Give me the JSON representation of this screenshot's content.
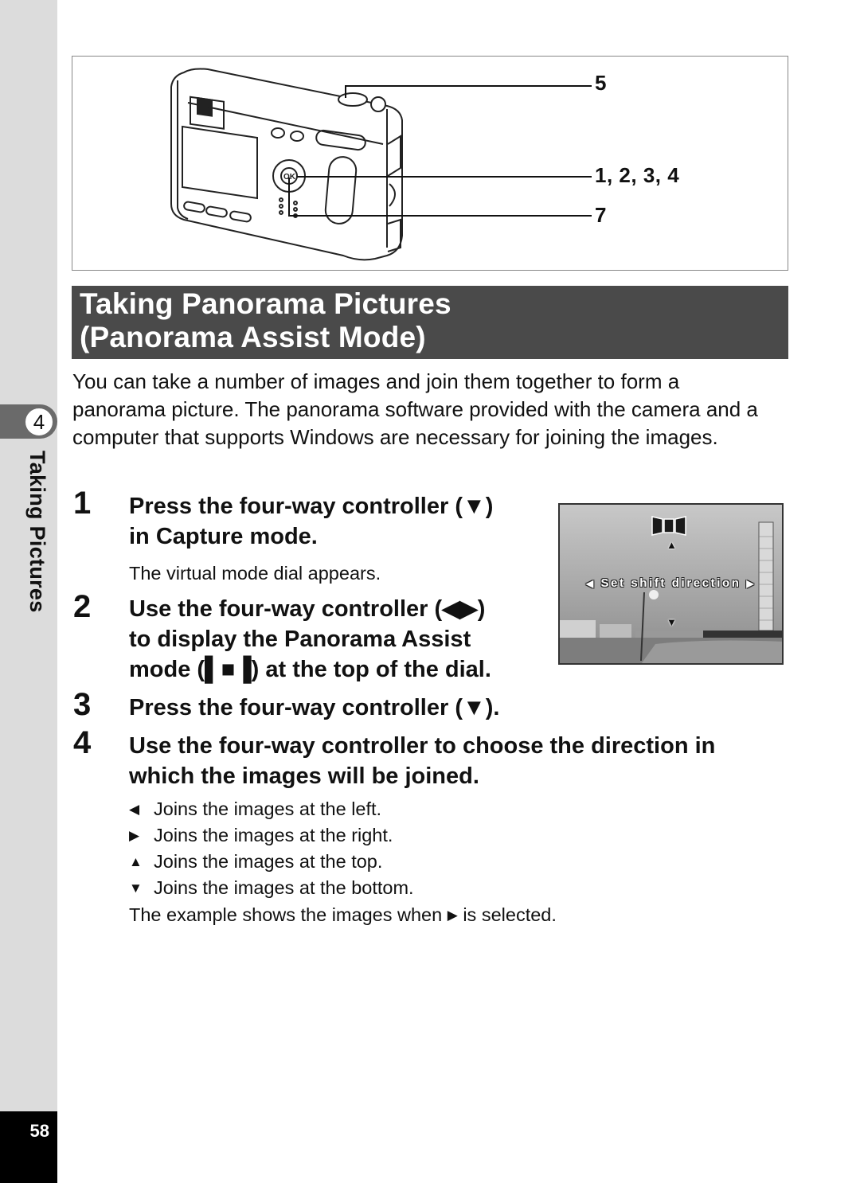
{
  "sidebar": {
    "chapter_number": "4",
    "chapter_label": "Taking Pictures",
    "page_number": "58"
  },
  "illustration": {
    "icon": "camera-back-view-icon",
    "callouts": {
      "shutter": "5",
      "controller": "1, 2, 3, 4",
      "ok_button": "7"
    }
  },
  "section": {
    "title_line1": "Taking Panorama Pictures",
    "title_line2": "(Panorama Assist Mode)"
  },
  "intro": "You can take a number of images and join them together to form a panorama picture. The panorama software provided with the camera and a computer that supports Windows are necessary for joining the images.",
  "steps": [
    {
      "number": "1",
      "lines": [
        "Press the four-way controller (▼)",
        "in Capture mode."
      ],
      "note": "The virtual mode dial appears."
    },
    {
      "number": "2",
      "lines": [
        "Use the four-way controller (◀▶)",
        "to display the Panorama Assist",
        "mode (▌■▐) at the top of the dial."
      ]
    },
    {
      "number": "3",
      "lines": [
        "Press the four-way controller (▼)."
      ]
    },
    {
      "number": "4",
      "lines": [
        "Use the four-way controller to choose the direction in",
        "which the images will be joined."
      ],
      "options": [
        {
          "icon": "left-arrow-icon",
          "glyph": "◀",
          "text": "Joins the images at the left."
        },
        {
          "icon": "right-arrow-icon",
          "glyph": "▶",
          "text": "Joins the images at the right."
        },
        {
          "icon": "up-arrow-icon",
          "glyph": "▲",
          "text": "Joins the images at the top."
        },
        {
          "icon": "down-arrow-icon",
          "glyph": "▼",
          "text": "Joins the images at the bottom."
        }
      ],
      "footer_before": "The example shows the images when",
      "footer_glyph": "▶",
      "footer_after": "is selected."
    }
  ],
  "lcd_screen": {
    "mode_icon": "panorama-assist-icon",
    "message": "Set shift direction",
    "arrow_left": "◀",
    "arrow_right": "▶",
    "arrow_up": "▲",
    "arrow_down": "▼"
  }
}
